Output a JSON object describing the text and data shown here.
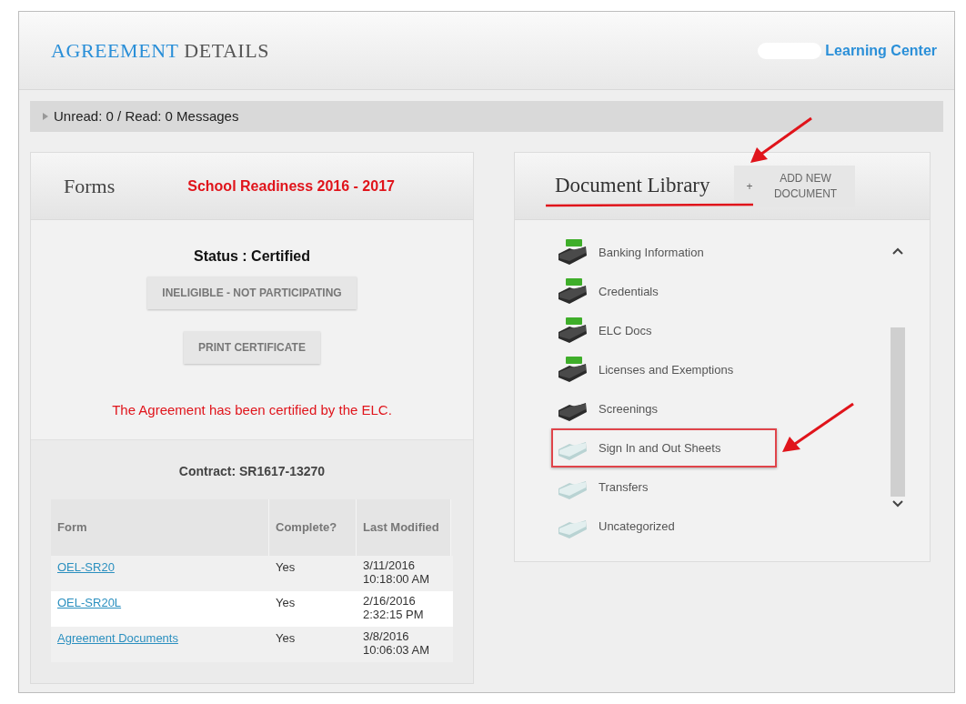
{
  "header": {
    "title_accent": "AGREEMENT",
    "title_rest": "DETAILS",
    "link": "Learning Center"
  },
  "messages": {
    "expanded": false,
    "label": "Unread: 0 / Read: 0 Messages"
  },
  "forms": {
    "title": "Forms",
    "program": "School Readiness 2016 - 2017",
    "status": "Status : Certified",
    "buttons": [
      "INELIGIBLE - NOT PARTICIPATING",
      "PRINT CERTIFICATE"
    ],
    "notice": "The Agreement has been certified by the ELC.",
    "contract": "Contract: SR1617-13270",
    "table": {
      "columns": [
        "Form",
        "Complete?",
        "Last Modified"
      ],
      "rows": [
        {
          "form": "OEL-SR20",
          "complete": "Yes",
          "modified": "3/11/2016 10:18:00 AM"
        },
        {
          "form": "OEL-SR20L",
          "complete": "Yes",
          "modified": "2/16/2016 2:32:15 PM"
        },
        {
          "form": "Agreement Documents",
          "complete": "Yes",
          "modified": "3/8/2016 10:06:03 AM"
        }
      ]
    }
  },
  "library": {
    "title": "Document Library",
    "add_button": {
      "icon": "+",
      "label": "ADD NEW DOCUMENT"
    },
    "folders": [
      {
        "name": "Banking Information",
        "kind": "filled",
        "new": true,
        "highlighted": false
      },
      {
        "name": "Credentials",
        "kind": "filled",
        "new": true,
        "highlighted": false
      },
      {
        "name": "ELC Docs",
        "kind": "filled",
        "new": true,
        "highlighted": false
      },
      {
        "name": "Licenses and Exemptions",
        "kind": "filled",
        "new": true,
        "highlighted": false
      },
      {
        "name": "Screenings",
        "kind": "filled",
        "new": false,
        "highlighted": false
      },
      {
        "name": "Sign In and Out Sheets",
        "kind": "empty",
        "new": false,
        "highlighted": true
      },
      {
        "name": "Transfers",
        "kind": "empty",
        "new": false,
        "highlighted": false
      },
      {
        "name": "Uncategorized",
        "kind": "empty",
        "new": false,
        "highlighted": false
      }
    ]
  }
}
